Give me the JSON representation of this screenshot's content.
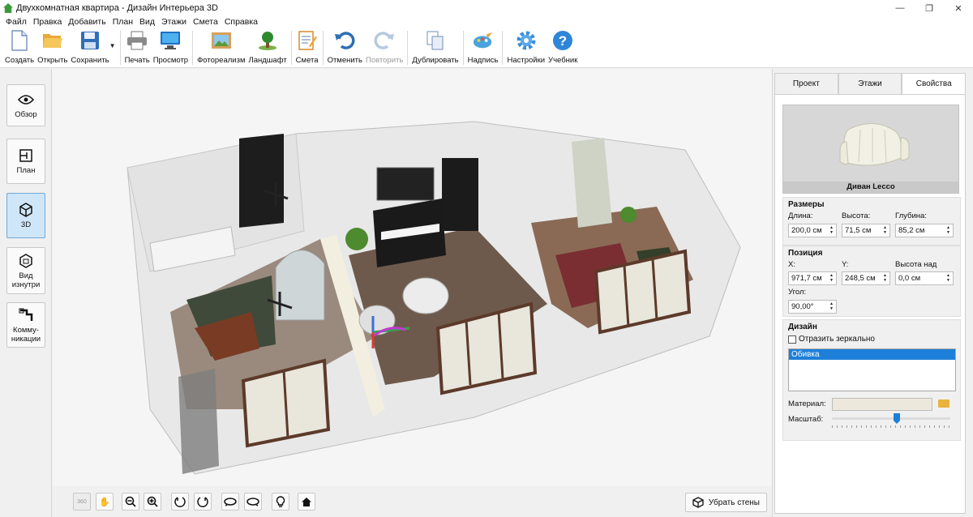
{
  "window": {
    "title": "Двухкомнатная квартира - Дизайн Интерьера 3D",
    "minimize": "—",
    "maximize": "❐",
    "close": "✕"
  },
  "menu": [
    "Файл",
    "Правка",
    "Добавить",
    "План",
    "Вид",
    "Этажи",
    "Смета",
    "Справка"
  ],
  "toolbar": {
    "create": "Создать",
    "open": "Открыть",
    "save": "Сохранить",
    "print": "Печать",
    "preview": "Просмотр",
    "photorealism": "Фотореализм",
    "landscape": "Ландшафт",
    "estimate": "Смета",
    "undo": "Отменить",
    "redo": "Повторить",
    "duplicate": "Дублировать",
    "caption": "Надпись",
    "settings": "Настройки",
    "tutorial": "Учебник"
  },
  "left_panel": {
    "overview": "Обзор",
    "plan": "План",
    "view3d": "3D",
    "inside_view_1": "Вид",
    "inside_view_2": "изнутри",
    "utilities_1": "Комму-",
    "utilities_2": "никации"
  },
  "bottom_bar": {
    "remove_walls": "Убрать стены",
    "rotate_label": "360"
  },
  "right_panel": {
    "tabs": [
      "Проект",
      "Этажи",
      "Свойства"
    ],
    "active_tab": "Свойства",
    "preview_label": "Диван Lecco",
    "sizes": {
      "title": "Размеры",
      "length_label": "Длина:",
      "length": "200,0 см",
      "height_label": "Высота:",
      "height": "71,5 см",
      "depth_label": "Глубина:",
      "depth": "85,2 см"
    },
    "position": {
      "title": "Позиция",
      "x_label": "X:",
      "x": "971,7 см",
      "y_label": "Y:",
      "y": "248,5 см",
      "floor_label": "Высота над полом:",
      "floor": "0,0 см",
      "angle_label": "Угол:",
      "angle": "90,00°"
    },
    "design": {
      "title": "Дизайн",
      "mirror": "Отразить зеркально",
      "list_item": "Обивка",
      "material_label": "Материал:",
      "scale_label": "Масштаб:"
    }
  },
  "colors": {
    "accent": "#1e7fd8",
    "selected_tool": "#cfe6f8"
  }
}
